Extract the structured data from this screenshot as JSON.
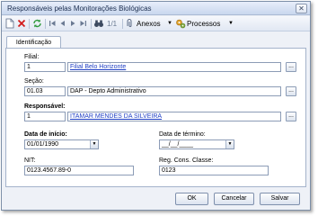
{
  "window": {
    "title": "Responsáveis pelas Monitorações Biológicas",
    "close": "✕"
  },
  "toolbar": {
    "new_icon": "new-document-icon",
    "delete_icon": "delete-icon",
    "refresh_icon": "refresh-icon",
    "first_icon": "first-record-icon",
    "prev_icon": "previous-record-icon",
    "next_icon": "next-record-icon",
    "last_icon": "last-record-icon",
    "search_icon": "binoculars-icon",
    "record_counter": "1/1",
    "attachments_label": "Anexos",
    "processes_label": "Processos"
  },
  "tabs": [
    {
      "label": "Identificação"
    }
  ],
  "form": {
    "filial_label": "Filial:",
    "filial_code": "1",
    "filial_name": "Filial Belo Horizonte",
    "secao_label": "Seção:",
    "secao_code": "01.03",
    "secao_name": "DAP - Depto Administrativo",
    "responsavel_label": "Responsável:",
    "responsavel_code": "1",
    "responsavel_name": "ITAMAR MENDES DA SILVEIRA",
    "data_inicio_label": "Data de início:",
    "data_inicio_value": "01/01/1990",
    "data_termino_label": "Data de término:",
    "data_termino_value": "__/__/____",
    "nit_label": "NIT:",
    "nit_value": "0123.4567.89-0",
    "reg_cons_label": "Reg. Cons. Classe:",
    "reg_cons_value": "0123",
    "ellipsis": "..."
  },
  "buttons": {
    "ok": "OK",
    "cancel": "Cancelar",
    "save": "Salvar"
  },
  "colors": {
    "link": "#1f3fc4",
    "window_bg": "#eef1f7",
    "title_text": "#1b2d4f"
  }
}
